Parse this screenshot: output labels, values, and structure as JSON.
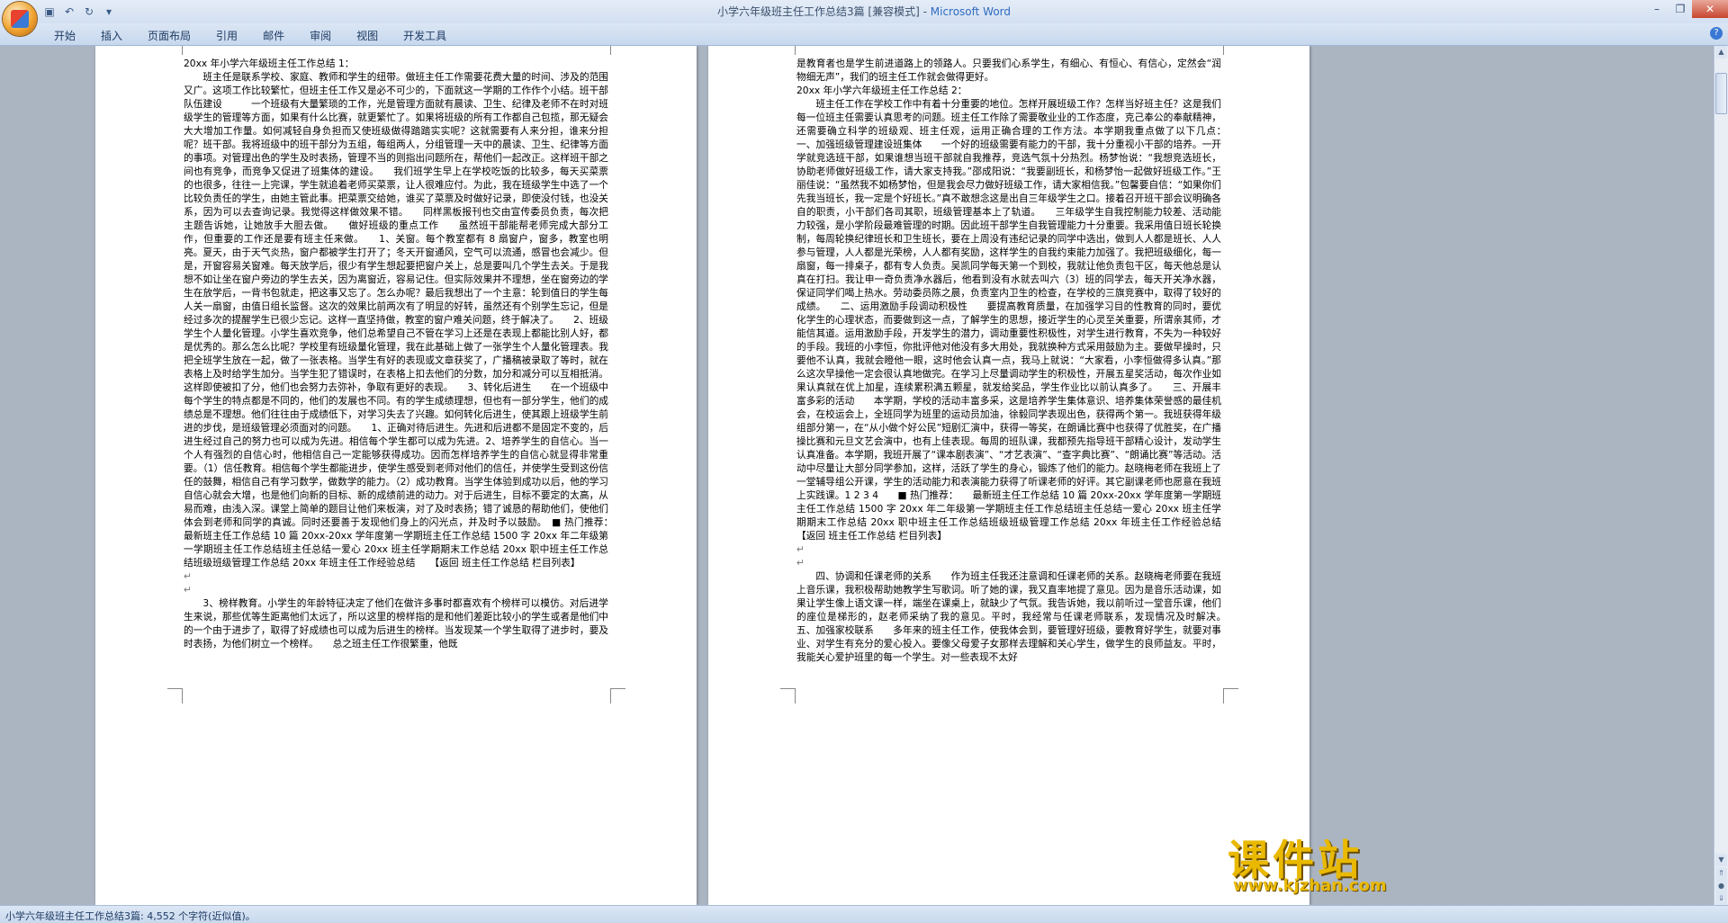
{
  "window": {
    "title_doc": "小学六年级班主任工作总结3篇 [兼容模式] - ",
    "title_app": "Microsoft Word"
  },
  "ribbon": {
    "tabs": [
      "开始",
      "插入",
      "页面布局",
      "引用",
      "邮件",
      "审阅",
      "视图",
      "开发工具"
    ]
  },
  "status": {
    "text": "小学六年级班主任工作总结3篇: 4,552 个字符(近似值)。"
  },
  "watermark": {
    "big": "课件站",
    "url": "www.kjzhan.com"
  },
  "left_page": {
    "paragraphs": [
      "20xx 年小学六年级班主任工作总结 1：",
      "班主任是联系学校、家庭、教师和学生的纽带。做班主任工作需要花费大量的时间、涉及的范围又广。这项工作比较繁忙，但班主任工作又是必不可少的，下面就这一学期的工作作个小结。班干部队伍建设　　　一个班级有大量繁琐的工作，光是管理方面就有晨读、卫生、纪律及老师不在时对班级学生的管理等方面，如果有什么比赛，就更繁忙了。如果将班级的所有工作都自己包揽，那无疑会大大增加工作量。如何减轻自身负担而又使班级做得踏踏实实呢？这就需要有人来分担，谁来分担呢？班干部。我将班级中的班干部分为五组，每组两人，分组管理一天中的晨读、卫生、纪律等方面的事项。对管理出色的学生及时表扬，管理不当的则指出问题所在，帮他们一起改正。这样班干部之间也有竞争，而竞争又促进了班集体的建设。　　我们班学生早上在学校吃饭的比较多，每天买菜票的也很多，往往一上完课，学生就追着老师买菜票，让人很难应付。为此，我在班级学生中选了一个比较负责任的学生，由她主管此事。把菜票交给她，谁买了菜票及时做好记录，即使没付钱，也没关系，因为可以去查询记录。我觉得这样做效果不错。　　同样黑板报刊也交由宣传委员负责，每次把主题告诉她，让她放手大胆去做。　　做好班级的重点工作　　虽然班干部能帮老师完成大部分工作，但重要的工作还是要有班主任来做。　　1、关窗。每个教室都有 8 扇窗户，窗多，教室也明亮。夏天，由于天气炎热，窗户都被学生打开了；冬天开窗通风，空气可以流通，感冒也会减少。但是，开窗容易关窗难。每天放学后，很少有学生想起要把窗户关上，总是要叫几个学生去关。于是我想不如让坐在窗户旁边的学生去关，因为离窗近，容易记住。但实际效果并不理想，坐在窗旁边的学生在放学后，一背书包就走，把这事又忘了。怎么办呢？最后我想出了一个主意：轮到值日的学生每人关一扇窗，由值日组长监督。这次的效果比前两次有了明显的好转，虽然还有个别学生忘记，但是经过多次的提醒学生已很少忘记。这样一直坚持做，教室的窗户难关问题，终于解决了。　　2、班级学生个人量化管理。小学生喜欢竞争，他们总希望自己不管在学习上还是在表现上都能比别人好，都是优秀的。那么怎么比呢？学校里有班级量化管理，我在此基础上做了一张学生个人量化管理表。我把全班学生放在一起，做了一张表格。当学生有好的表现或文章获奖了，广播稿被录取了等时，就在表格上及时给学生加分。当学生犯了错误时，在表格上扣去他们的分数，加分和减分可以互相抵消。这样即使被扣了分，他们也会努力去弥补，争取有更好的表现。　　3、转化后进生　　在一个班级中每个学生的特点都是不同的，他们的发展也不同。有的学生成绩理想，但也有一部分学生，他们的成绩总是不理想。他们往往由于成绩低下，对学习失去了兴趣。如何转化后进生，使其跟上班级学生前进的步伐，是班级管理必须面对的问题。　　1、正确对待后进生。先进和后进都不是固定不变的，后进生经过自己的努力也可以成为先进。相信每个学生都可以成为先进。2、培养学生的自信心。当一个人有强烈的自信心时，他相信自己一定能够获得成功。因而怎样培养学生的自信心就显得非常重要。（1）信任教育。相信每个学生都能进步，使学生感受到老师对他们的信任，并使学生受到这份信任的鼓舞，相信自己有学习数学，做数学的能力。（2）成功教育。当学生体验到成功以后，他的学习自信心就会大增，也是他们向新的目标、新的成绩前进的动力。对于后进生，目标不要定的太高，从易而难，由浅入深。课堂上简单的题目让他们来板演，对了及时表扬；错了诚恳的帮助他们，使他们体会到老师和同学的真诚。同时还要善于发现他们身上的闪光点，并及时予以鼓励。　■ 热门推荐：　　最新班主任工作总结 10 篇 20xx-20xx 学年度第一学期班主任工作总结 1500 字 20xx 年二年级第一学期班主任工作总结班主任总结一爱心 20xx 班主任学期期末工作总结 20xx 职中班主任工作总结班级班级管理工作总结 20xx 年班主任工作经验总结　　【返回 班主任工作总结 栏目列表】",
      "↵",
      "↵",
      "3、榜样教育。小学生的年龄特征决定了他们在做许多事时都喜欢有个榜样可以模仿。对后进学生来说，那些优等生距离他们太远了，所以这里的榜样指的是和他们差距比较小的学生或者是他们中的一个由于进步了，取得了好成绩也可以成为后进生的榜样。当发现某一个学生取得了进步时，要及时表扬，为他们树立一个榜样。　　总之班主任工作很繁重，他既"
    ]
  },
  "right_page": {
    "paragraphs": [
      "是教育者也是学生前进道路上的领路人。只要我们心系学生，有细心、有恒心、有信心，定然会“润物细无声”，我们的班主任工作就会做得更好。",
      "20xx 年小学六年级班主任工作总结 2：",
      "班主任工作在学校工作中有着十分重要的地位。怎样开展班级工作？怎样当好班主任？这是我们每一位班主任需要认真思考的问题。班主任工作除了需要敬业业的工作态度，克己奉公的奉献精神，还需要确立科学的班级观、班主任观，运用正确合理的工作方法。本学期我重点做了以下几点：　　一、加强班级管理建设班集体　　一个好的班级需要有能力的干部，我十分重视小干部的培养。一开学就竞选班干部，如果谁想当班干部就自我推荐，竞选气氛十分热烈。杨梦怡说：“我想竞选班长，协助老师做好班级工作，请大家支持我。”邵成阳说：“我要副班长，和杨梦怡一起做好班级工作。”王丽佳说：“虽然我不如杨梦怡，但是我会尽力做好班级工作，请大家相信我。”包馨要自信：“如果你们先我当班长，我一定是个好班长。”真不敢想念这是出自三年级学生之口。接着召开班干部会议明确各自的职责，小干部们各司其职，班级管理基本上了轨道。　　三年级学生自我控制能力较差、活动能力较强，是小学阶段最难管理的时期。因此班干部学生自我管理能力十分重要。我采用值日班长轮换制，每周轮换纪律班长和卫生班长，要在上周没有违纪记录的同学中选出，做到人人都是班长、人人参与管理，人人都是光荣榜，人人都有奖励，这样学生的自我约束能力加强了。我把班级细化，每一扇窗，每一排桌子，都有专人负责。吴凯同学每天第一个到校，我就让他负责包干区，每天他总是认真在打扫。我让申一奇负责净水器后，他看到没有水就去叫六（3）班的同学去，每天开关净水器，保证同学们喝上热水。劳动委员陈之晨，负责室内卫生的检查，在学校的三旗竞赛中，取得了较好的成绩。　　二、运用激励手段调动积极性　　要提高教育质量，在加强学习目的性教育的同时，要优化学生的心理状态，而要做到这一点，了解学生的思想，接近学生的心灵至关重要，所谓亲其师，才能信其道。运用激励手段，开发学生的潜力，调动重要性积极性，对学生进行教育，不失为一种较好的手段。我班的小李恒，你批评他对他没有多大用处，我就换种方式采用鼓励为主。要做早操时，只要他不认真，我就会瞪他一眼，这时他会认真一点，我马上就说：“大家看，小李恒做得多认真。”那么这次早操他一定会很认真地做完。在学习上尽量调动学生的积极性，开展五星奖活动，每次作业如果认真就在优上加星，连续累积满五颗星，就发给奖品，学生作业比以前认真多了。　　三、开展丰富多彩的活动　　本学期，学校的活动丰富多采，这是培养学生集体意识、培养集体荣誉感的最佳机会，在校运会上，全班同学为班里的运动员加油，徐毅同学表现出色，获得两个第一。我班获得年级组部分第一，在“从小做个好公民”短剧汇演中，获得一等奖，在朗诵比赛中也获得了优胜奖，在广播操比赛和元旦文艺会演中，也有上佳表现。每周的班队课，我都预先指导班干部精心设计，发动学生认真准备。本学期，我班开展了“课本剧表演”、“才艺表演”、“查字典比赛”、“朗诵比赛”等活动。活动中尽量让大部分同学参加，这样，活跃了学生的身心，锻炼了他们的能力。赵晓梅老师在我班上了一堂辅导组公开课，学生的活动能力和表演能力获得了听课老师的好评。其它副课老师也愿意在我班上实践课。1 2 3 4　　■ 热门推荐：　　最新班主任工作总结 10 篇 20xx-20xx 学年度第一学期班主任工作总结 1500 字 20xx 年二年级第一学期班主任工作总结班主任总结一爱心 20xx 班主任学期期末工作总结 20xx 职中班主任工作总结班级班级管理工作总结 20xx 年班主任工作经验总结　　【返回 班主任工作总结 栏目列表】",
      "↵",
      "↵",
      "四、协调和任课老师的关系　　作为班主任我还注意调和任课老师的关系。赵晓梅老师要在我班上音乐课，我积极帮助她教学生写歌词。听了她的课，我又直率地提了意见。因为是音乐活动课，如果让学生像上语文课一样，端坐在课桌上，就缺少了气氛。我告诉她，我以前听过一堂音乐课，他们的座位是梯形的，赵老师采纳了我的意见。平时，我经常与任课老师联系，发现情况及时解决。　　五、加强家校联系　　多年来的班主任工作，使我体会到，要管理好班级，要教育好学生，就要对事业、对学生有充分的爱心投入。要像父母爱子女那样去理解和关心学生，做学生的良师益友。平时，我能关心爱护班里的每一个学生。对一些表现不太好"
    ]
  }
}
